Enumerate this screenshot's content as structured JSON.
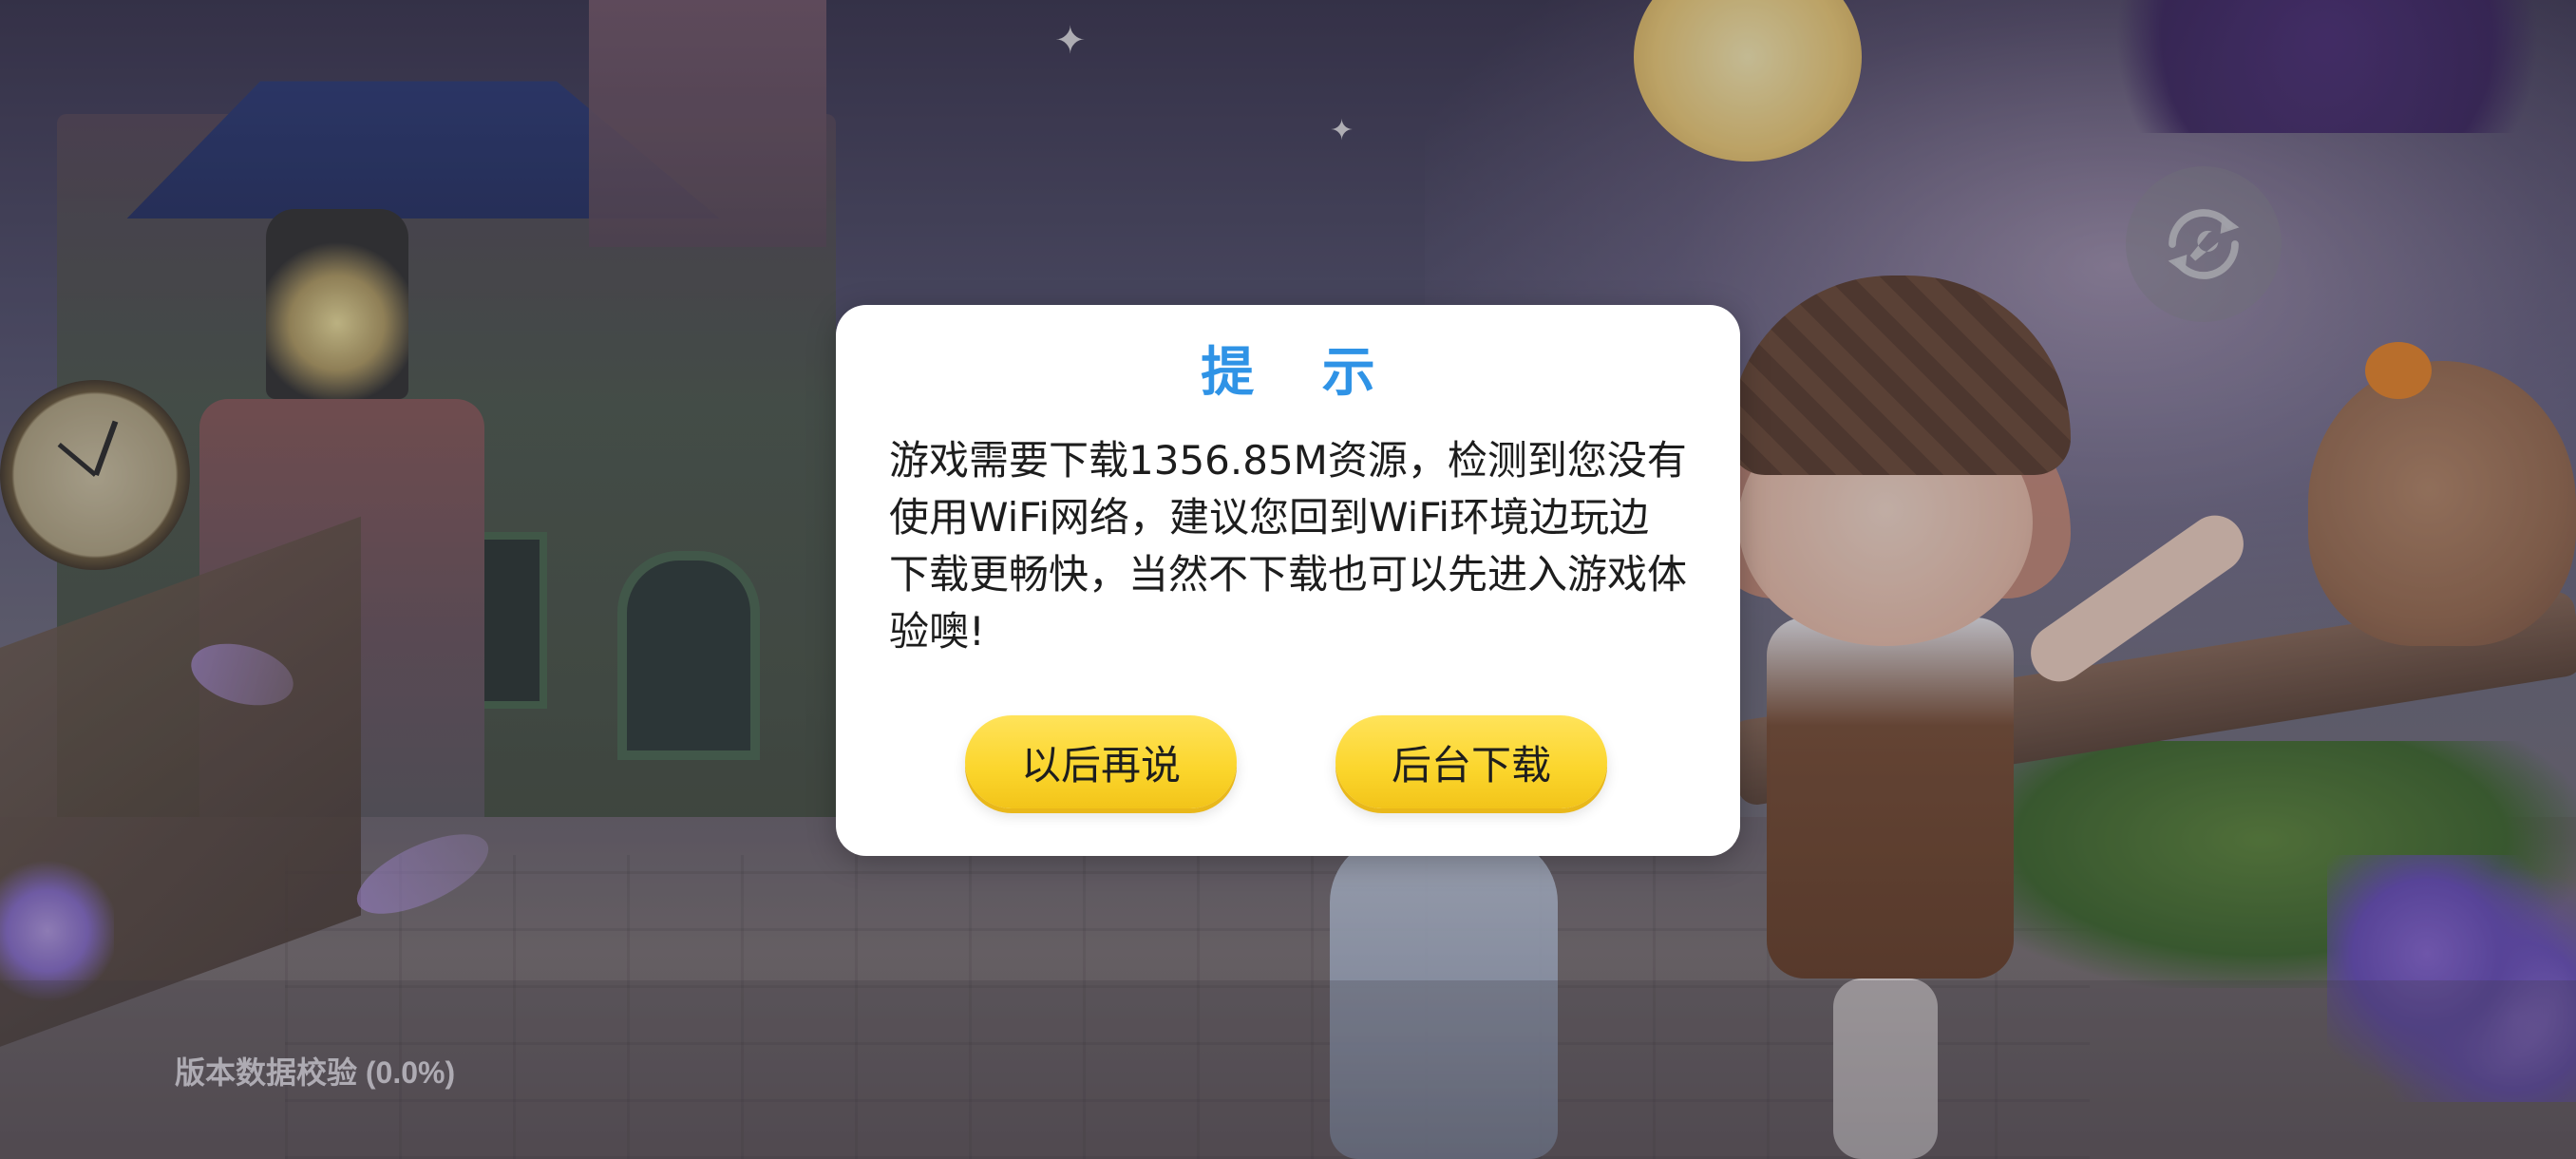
{
  "dialog": {
    "title": "提 示",
    "message": "游戏需要下载1356.85M资源，检测到您没有使用WiFi网络，建议您回到WiFi环境边玩边下载更畅快，当然不下载也可以先进入游戏体验噢!",
    "buttons": {
      "later_label": "以后再说",
      "background_download_label": "后台下载"
    }
  },
  "status": {
    "version_check_text": "版本数据校验 (0.0%)",
    "progress": 0.0
  },
  "icons": {
    "repair": "repair-refresh-icon"
  },
  "colors": {
    "title_blue": "#2f93e6",
    "button_yellow": "#fbd52b",
    "dialog_bg": "#ffffff"
  }
}
